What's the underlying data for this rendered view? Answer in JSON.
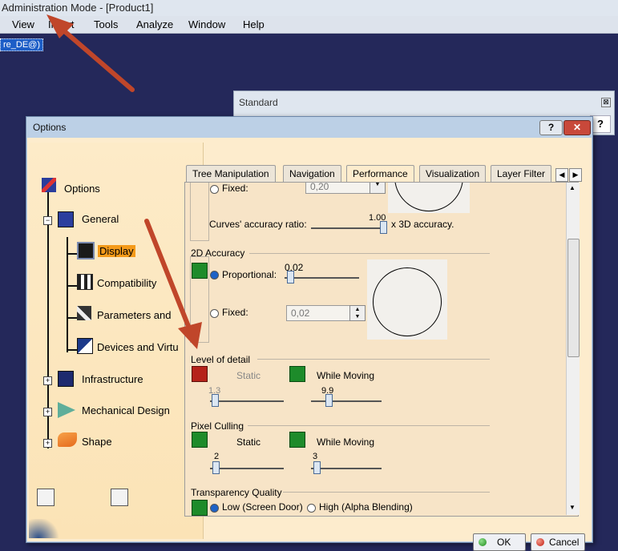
{
  "app": {
    "title": "Administration Mode - [Product1]",
    "menus": [
      "View",
      "Insert",
      "Tools",
      "Analyze",
      "Window",
      "Help"
    ],
    "background_tag": "re_DE@)"
  },
  "standard_toolbar": {
    "title": "Standard",
    "close_glyph": "⊠",
    "help_glyph": "?"
  },
  "dialog": {
    "title": "Options",
    "help_glyph": "?",
    "close_glyph": "✕",
    "ok_label": "OK",
    "cancel_label": "Cancel"
  },
  "tree": {
    "root": "Options",
    "items": [
      {
        "label": "General",
        "icon": "general-icon"
      },
      {
        "label": "Display",
        "icon": "display-icon",
        "selected": true
      },
      {
        "label": "Compatibility",
        "icon": "compatibility-icon"
      },
      {
        "label": "Parameters and",
        "icon": "parameters-icon"
      },
      {
        "label": "Devices and Virtu",
        "icon": "devices-icon"
      },
      {
        "label": "Infrastructure",
        "icon": "infrastructure-icon"
      },
      {
        "label": "Mechanical Design",
        "icon": "mechanical-design-icon"
      },
      {
        "label": "Shape",
        "icon": "shape-icon"
      }
    ]
  },
  "tabs": [
    "Tree Manipulation",
    "Navigation",
    "Performance",
    "Visualization",
    "Layer Filter"
  ],
  "tab_arrows": [
    "◀",
    "▶"
  ],
  "scroll_arrows": [
    "▲",
    "▼"
  ],
  "spin_arrows": [
    "▲",
    "▼"
  ],
  "performance": {
    "accuracy3d": {
      "fixed_label": "Fixed:",
      "fixed_value": "0,20",
      "curves_ratio_label": "Curves' accuracy ratio:",
      "curves_ratio_value": "1.00",
      "curves_ratio_suffix": "x 3D accuracy."
    },
    "accuracy2d": {
      "title": "2D Accuracy",
      "proportional_label": "Proportional:",
      "proportional_value": "0.02",
      "fixed_label": "Fixed:",
      "fixed_value": "0,02"
    },
    "level_of_detail": {
      "title": "Level of detail",
      "static_label": "Static",
      "static_value": "1.3",
      "moving_label": "While Moving",
      "moving_value": "9.9"
    },
    "pixel_culling": {
      "title": "Pixel Culling",
      "static_label": "Static",
      "static_value": "2",
      "moving_label": "While Moving",
      "moving_value": "3"
    },
    "transparency": {
      "title": "Transparency Quality",
      "low_label": "Low (Screen Door)",
      "high_label": "High (Alpha Blending)"
    }
  },
  "colors": {
    "accent": "#f49a1a",
    "arrow": "#c0462a",
    "lock_green": "#1d8b2a",
    "lock_red": "#b5231a"
  }
}
